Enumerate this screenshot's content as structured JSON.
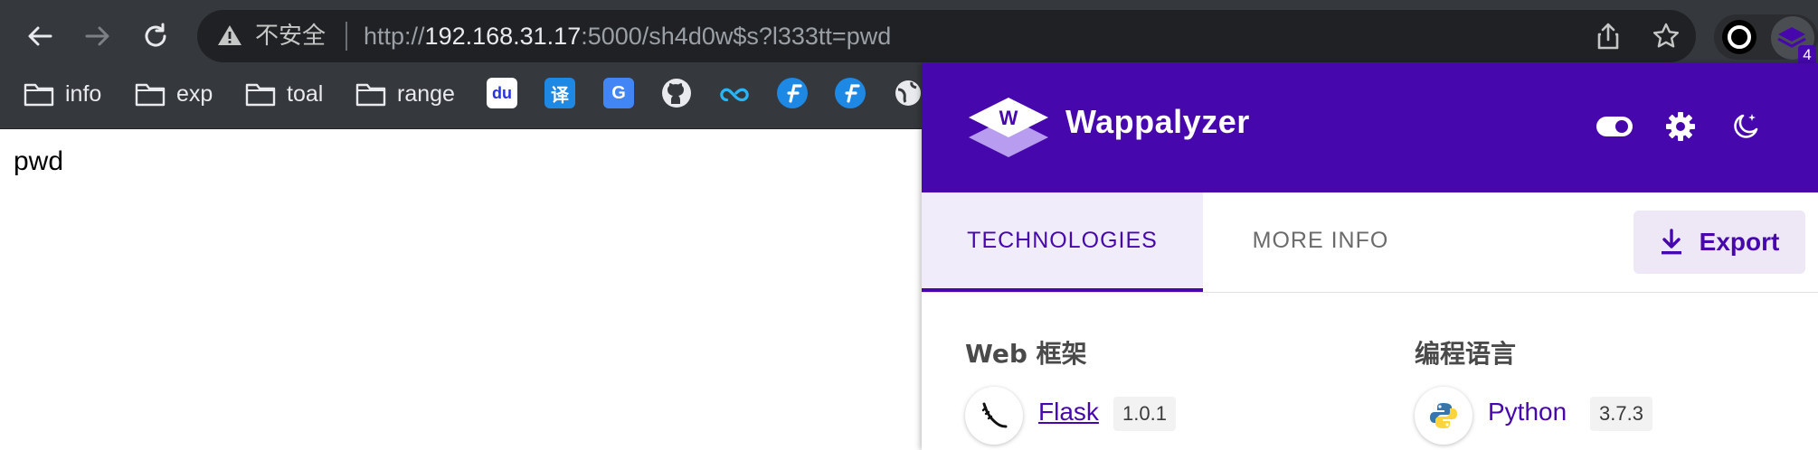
{
  "browser": {
    "security_label": "不安全",
    "url_prefix": "http://",
    "url_host": "192.168.31.17",
    "url_rest": ":5000/sh4d0w$s?l333tt=pwd",
    "extension_badge": "4"
  },
  "bookmarks": [
    {
      "label": "info"
    },
    {
      "label": "exp"
    },
    {
      "label": "toal"
    },
    {
      "label": "range"
    }
  ],
  "bookmark_icons": {
    "baidu": "du",
    "translate": "译",
    "gtranslate": "G"
  },
  "page": {
    "body_text": "pwd"
  },
  "wappalyzer": {
    "title": "Wappalyzer",
    "tabs": {
      "technologies": "TECHNOLOGIES",
      "more_info": "MORE INFO"
    },
    "export_label": "Export",
    "categories": [
      {
        "title": "Web 框架",
        "tech": {
          "name": "Flask",
          "version": "1.0.1"
        }
      },
      {
        "title": "编程语言",
        "tech": {
          "name": "Python",
          "version": "3.7.3"
        }
      }
    ]
  },
  "colors": {
    "brand": "#4608ad",
    "chrome_bg": "#35383c",
    "omnibox_bg": "#202124"
  }
}
